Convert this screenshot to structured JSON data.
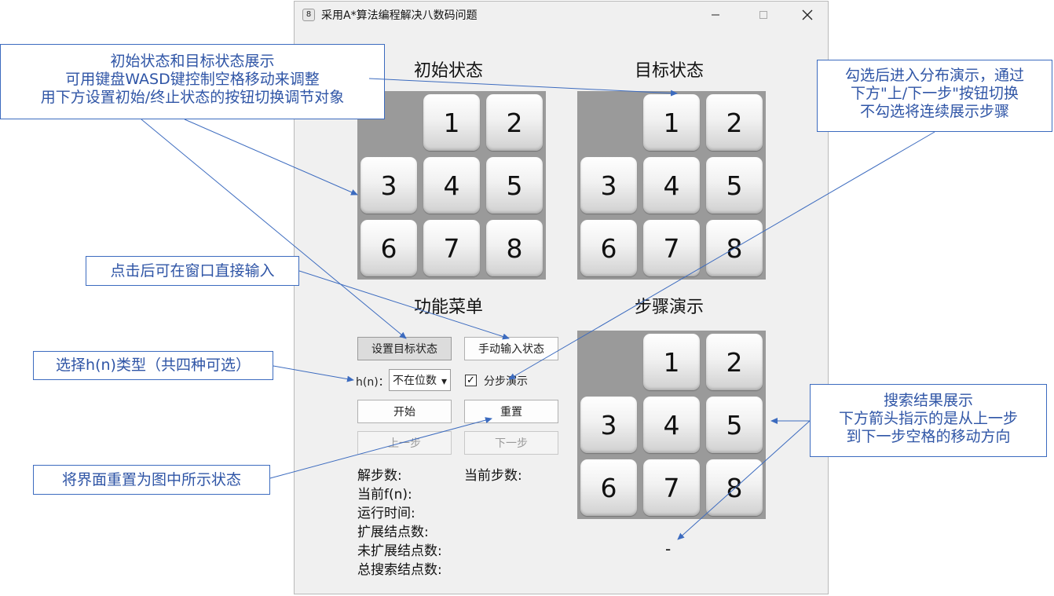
{
  "window": {
    "icon_glyph": "8",
    "title": "采用A*算法编程解决八数码问题",
    "minimize_glyph": "—",
    "maximize_glyph": "☐",
    "close_glyph": "✕"
  },
  "sections": {
    "initial_title": "初始状态",
    "goal_title": "目标状态",
    "menu_title": "功能菜单",
    "demo_title": "步骤演示"
  },
  "boards": {
    "initial": [
      "",
      "1",
      "2",
      "3",
      "4",
      "5",
      "6",
      "7",
      "8"
    ],
    "goal": [
      "",
      "1",
      "2",
      "3",
      "4",
      "5",
      "6",
      "7",
      "8"
    ],
    "demo": [
      "",
      "1",
      "2",
      "3",
      "4",
      "5",
      "6",
      "7",
      "8"
    ]
  },
  "menu": {
    "set_goal_button": "设置目标状态",
    "manual_input_button": "手动输入状态",
    "hn_label": "h(n)：",
    "hn_selected": "不在位数",
    "hn_arrow": "▾",
    "step_checkbox_mark": "✓",
    "step_checkbox_label": "分步演示",
    "start_button": "开始",
    "reset_button": "重置",
    "prev_button": "上一步",
    "next_button": "下一步"
  },
  "stats": {
    "solution_steps": "解步数:",
    "current_steps": "当前步数:",
    "current_fn": "当前f(n):",
    "run_time": "运行时间:",
    "expanded_nodes": "扩展结点数:",
    "unexpanded_nodes": "未扩展结点数:",
    "total_nodes": "总搜索结点数:",
    "step_direction": "-"
  },
  "annotations": {
    "states_display": [
      "初始状态和目标状态展示",
      "可用键盘WASD键控制空格移动来调整",
      "用下方设置初始/终止状态的按钮切换调节对象"
    ],
    "step_mode": [
      "勾选后进入分布演示，通过",
      "下方\"上/下一步\"按钮切换",
      "不勾选将连续展示步骤"
    ],
    "manual_input": [
      "点击后可在窗口直接输入"
    ],
    "hn_type": [
      "选择h(n)类型（共四种可选）"
    ],
    "reset": [
      "将界面重置为图中所示状态"
    ],
    "search_result": [
      "搜索结果展示",
      "下方箭头指示的是从上一步",
      "到下一步空格的移动方向"
    ]
  },
  "colors": {
    "annotation": "#3c6bbf",
    "board_background": "#9a9a9a"
  }
}
